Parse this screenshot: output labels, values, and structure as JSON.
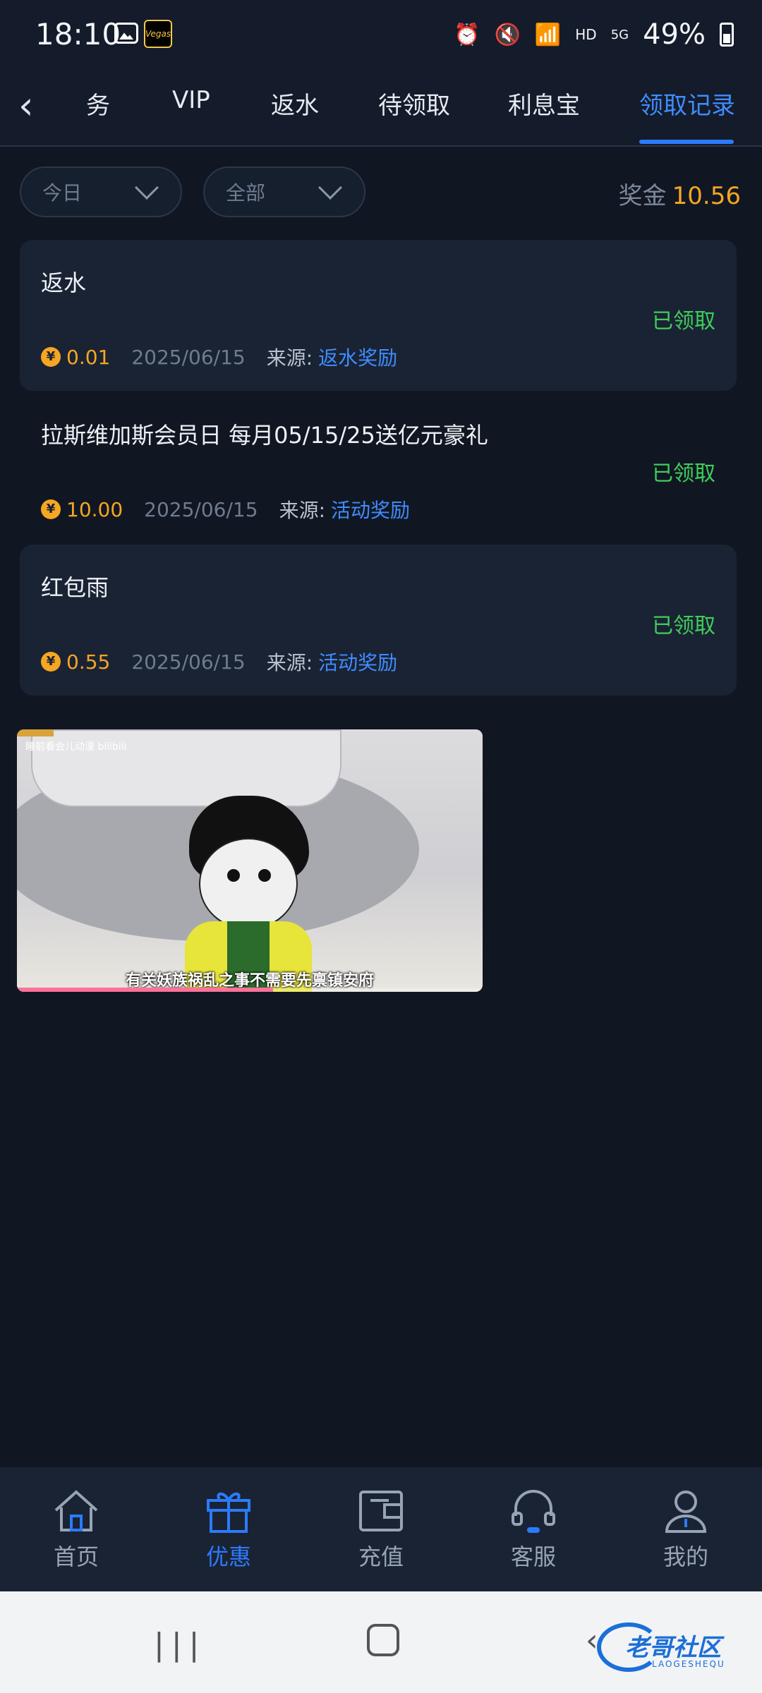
{
  "status_bar": {
    "time": "18:10",
    "network": "HD",
    "signal_label": "5G",
    "battery": "49%",
    "app_logo_text": "Vegas"
  },
  "nav": {
    "tabs": [
      "务",
      "VIP",
      "返水",
      "待领取",
      "利息宝",
      "领取记录"
    ],
    "active_tab": "领取记录"
  },
  "filters": {
    "date": "今日",
    "category": "全部",
    "bonus_label": "奖金",
    "bonus_amount": "10.56"
  },
  "records": [
    {
      "title": "返水",
      "status": "已领取",
      "amount": "0.01",
      "date": "2025/06/15",
      "source_label": "来源:",
      "source": "返水奖励"
    },
    {
      "title": "拉斯维加斯会员日 每月05/15/25送亿元豪礼",
      "status": "已领取",
      "amount": "10.00",
      "date": "2025/06/15",
      "source_label": "来源:",
      "source": "活动奖励"
    },
    {
      "title": "红包雨",
      "status": "已领取",
      "amount": "0.55",
      "date": "2025/06/15",
      "source_label": "来源:",
      "source": "活动奖励"
    }
  ],
  "video_overlay": {
    "brand": "睡前看会儿动漫 bilibili",
    "subtitle": "有关妖族祸乱之事不需要先禀镇安府",
    "progress_fraction": 0.55
  },
  "bottom_nav": {
    "items": [
      "首页",
      "优惠",
      "充值",
      "客服",
      "我的"
    ],
    "active": "优惠"
  },
  "watermark": {
    "text": "老哥社区",
    "sub": "LAOGESHEQU"
  },
  "colors": {
    "background": "#111722",
    "card": "#1a2333",
    "accent_blue": "#2b7bff",
    "gold": "#f5a623",
    "success_green": "#3fce5a"
  }
}
